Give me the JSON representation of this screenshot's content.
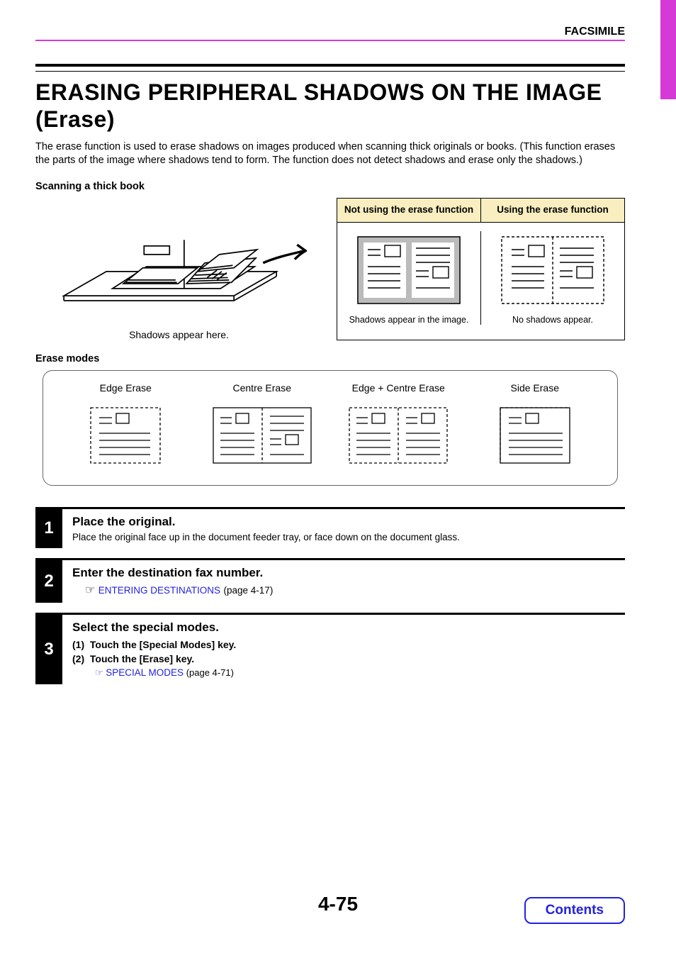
{
  "header": "FACSIMILE",
  "title": "ERASING PERIPHERAL SHADOWS ON THE IMAGE (Erase)",
  "intro": "The erase function is used to erase shadows on images produced when scanning thick originals or books. (This function erases the parts of the image where shadows tend to form. The function does not detect shadows and erase only the shadows.)",
  "section_book": "Scanning a thick book",
  "book_caption": "Shadows appear here.",
  "compare": {
    "left_head": "Not using the erase function",
    "right_head": "Using the erase function",
    "left_caption": "Shadows appear in the image.",
    "right_caption": "No shadows appear."
  },
  "section_modes": "Erase modes",
  "modes": {
    "m1": "Edge Erase",
    "m2": "Centre Erase",
    "m3": "Edge + Centre Erase",
    "m4": "Side Erase"
  },
  "steps": {
    "s1": {
      "num": "1",
      "title": "Place the original.",
      "text": "Place the original face up in the document feeder tray, or face down on the document glass."
    },
    "s2": {
      "num": "2",
      "title": "Enter the destination fax number.",
      "link": "ENTERING DESTINATIONS",
      "pageref": " (page 4-17)"
    },
    "s3": {
      "num": "3",
      "title": "Select the special modes.",
      "sub1": "(1)  Touch the [Special Modes] key.",
      "sub2": "(2)  Touch the [Erase] key.",
      "link": "SPECIAL MODES",
      "pageref": " (page 4-71)"
    }
  },
  "pagenum": "4-75",
  "contents": "Contents"
}
